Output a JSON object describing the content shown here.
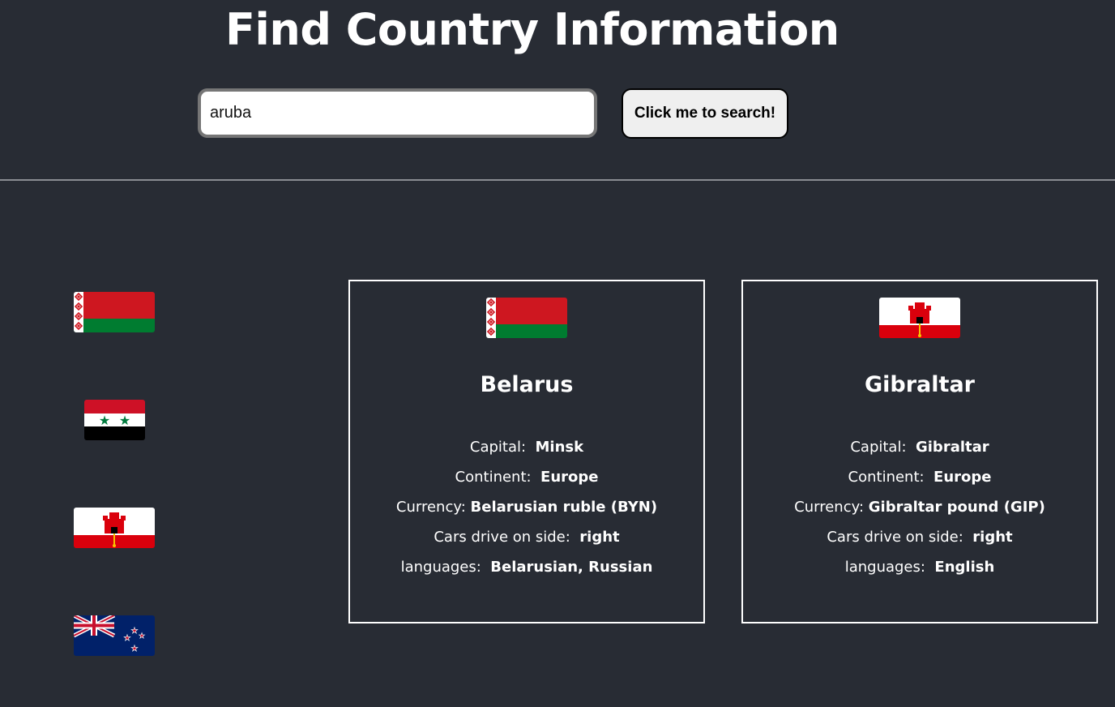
{
  "title": "Find Country Information",
  "search": {
    "value": "aruba",
    "placeholder": ""
  },
  "search_button_label": "Click me to search!",
  "side_flags": [
    {
      "country": "Belarus",
      "icon": "belarus-flag-icon"
    },
    {
      "country": "Syria",
      "icon": "syria-flag-icon"
    },
    {
      "country": "Gibraltar",
      "icon": "gibraltar-flag-icon"
    },
    {
      "country": "New Zealand",
      "icon": "new-zealand-flag-icon"
    }
  ],
  "cards": [
    {
      "name": "Belarus",
      "capital_label": "Capital:",
      "capital": "Minsk",
      "continent_label": "Continent:",
      "continent": "Europe",
      "currency_label": "Currency:",
      "currency": "Belarusian ruble (BYN)",
      "drive_label": "Cars drive on side:",
      "drive": "right",
      "languages_label": "languages:",
      "languages": "Belarusian, Russian"
    },
    {
      "name": "Gibraltar",
      "capital_label": "Capital:",
      "capital": "Gibraltar",
      "continent_label": "Continent:",
      "continent": "Europe",
      "currency_label": "Currency:",
      "currency": "Gibraltar pound (GIP)",
      "drive_label": "Cars drive on side:",
      "drive": "right",
      "languages_label": "languages:",
      "languages": "English"
    }
  ],
  "colors": {
    "background": "#282c34",
    "belarus_red": "#ce1720",
    "belarus_green": "#007c30",
    "gibraltar_red": "#da000c",
    "nz_blue": "#012169"
  }
}
